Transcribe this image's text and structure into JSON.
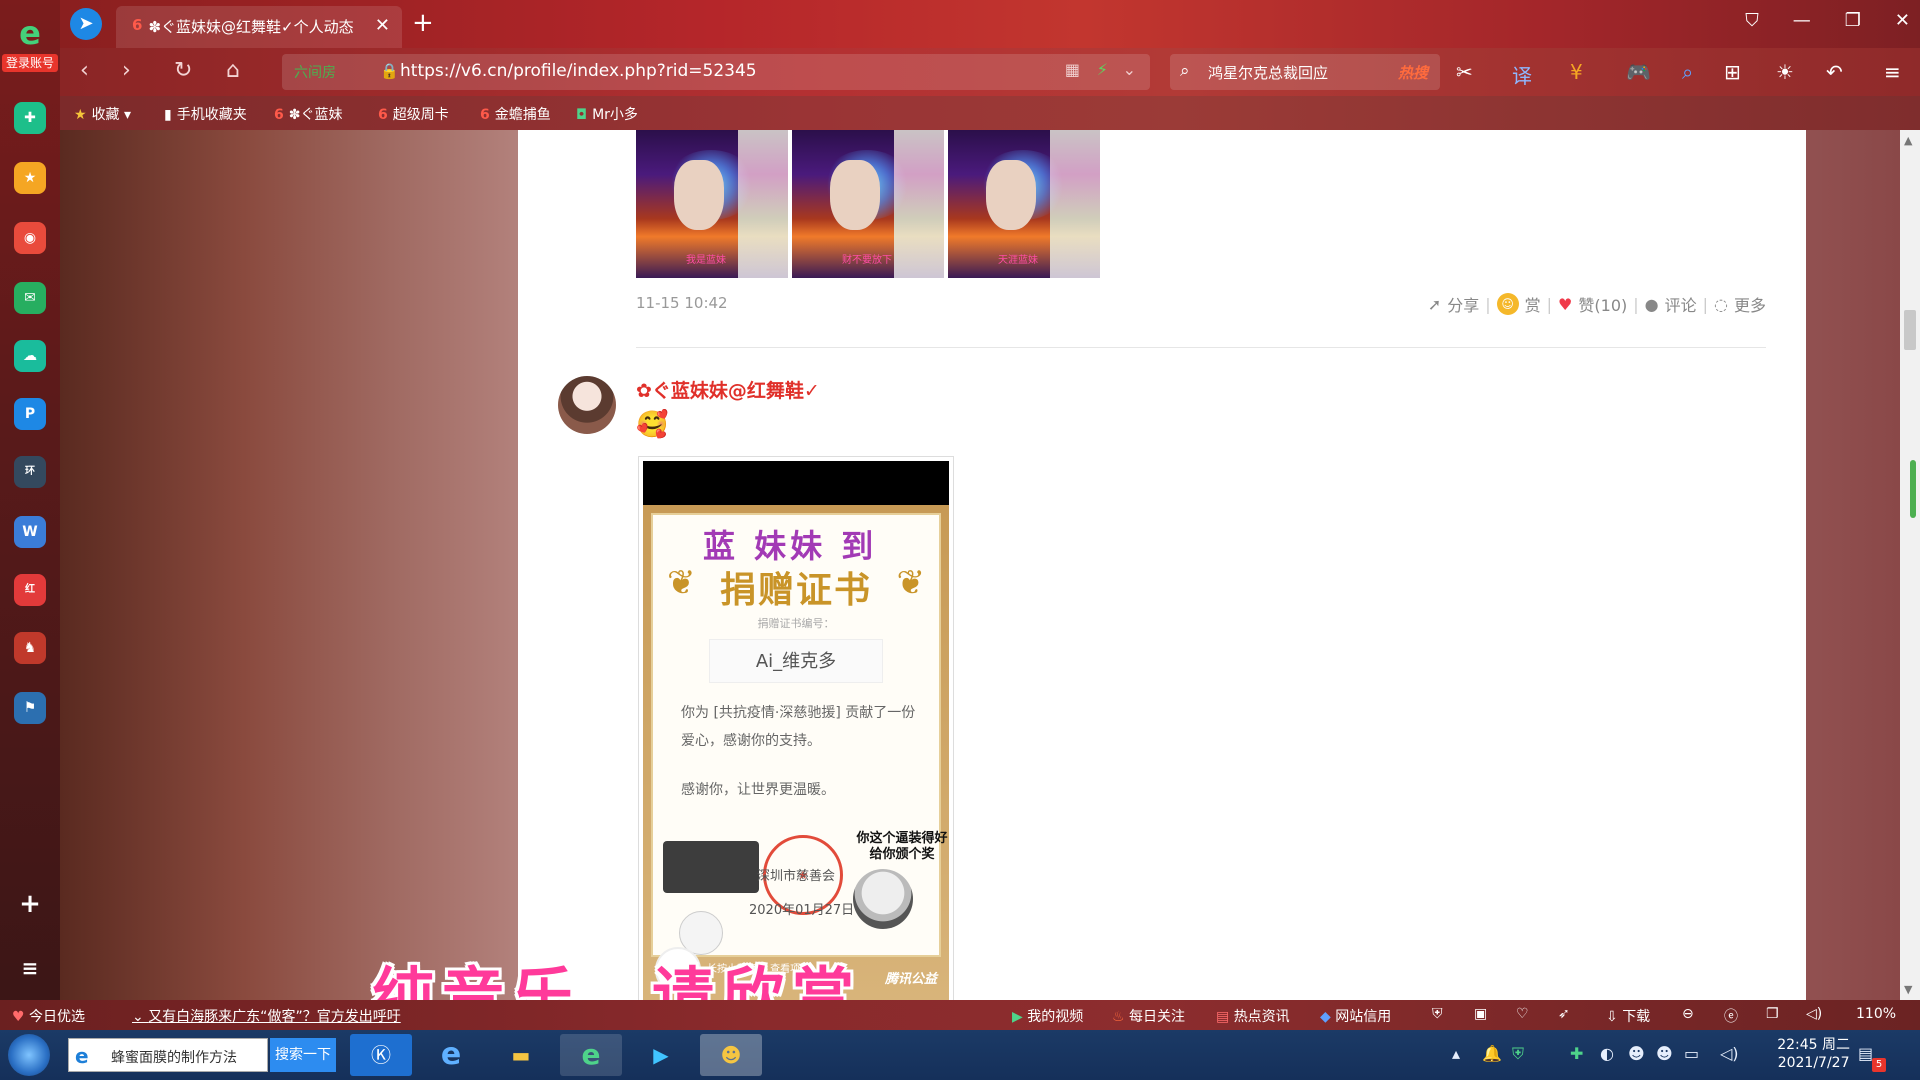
{
  "browser": {
    "tab_title": "✽ぐ蓝妹妹@红舞鞋✓个人动态",
    "tab_favicon": "6",
    "new_tab": "+",
    "cert_label": "六间房",
    "url": "https://v6.cn/profile/index.php?rid=52345",
    "search_query": "鸿星尔克总裁回应",
    "hot_label": "热搜",
    "sidebar_login": "登录账号"
  },
  "bookmarks": [
    {
      "icon": "★",
      "label": "收藏"
    },
    {
      "icon": "▮",
      "label": "手机收藏夹"
    },
    {
      "icon": "6",
      "label": "✽ぐ蓝妹"
    },
    {
      "icon": "6",
      "label": "超级周卡"
    },
    {
      "icon": "6",
      "label": "金蟾捕鱼"
    },
    {
      "icon": "◘",
      "label": "Mr小多"
    }
  ],
  "post_prev": {
    "time": "11-15 10:42",
    "thumb_captions": [
      "我是蓝妹",
      "财不要放下",
      "天涯蓝妹"
    ],
    "actions": {
      "share": "分享",
      "reward": "赏",
      "like": "赞(10)",
      "comment": "评论",
      "more": "更多"
    }
  },
  "post": {
    "username": "✿ぐ蓝妹妹@红舞鞋✓",
    "emoji": "🥰",
    "certificate": {
      "overlay": "蓝 妹妹 到",
      "title": "捐赠证书",
      "number_label": "捐赠证书编号：",
      "donor": "Ai_维克多",
      "body1": "你为 [共抗疫情·深慈驰援] 贡献了一份爱心，感谢你的支持。",
      "body2": "感谢你，让世界更温暖。",
      "org": "深圳市慈善会",
      "date": "2020年01月27日",
      "meme_text": "你这个逼装得好 给你颁个奖",
      "mini_program": "长按小程序码 查看项目",
      "brand": "腾讯公益"
    }
  },
  "subtitle": "纯音乐，请欣赏",
  "statusbar": {
    "today": "今日优选",
    "news": "又有白海豚来广东“做客”？官方发出呼吁",
    "my_video": "我的视频",
    "daily": "每日关注",
    "hot_news": "热点资讯",
    "credit": "网站信用",
    "download": "下载",
    "zoom": "110%"
  },
  "taskbar": {
    "search_query": "蜂蜜面膜的制作方法",
    "search_button": "搜索一下",
    "time": "22:45 周二",
    "date": "2021/7/27",
    "notif_count": "5"
  },
  "colors": {
    "accent_red": "#e0302a",
    "subtitle_pink": "#ff3a9a",
    "cert_gold": "#c99428"
  }
}
